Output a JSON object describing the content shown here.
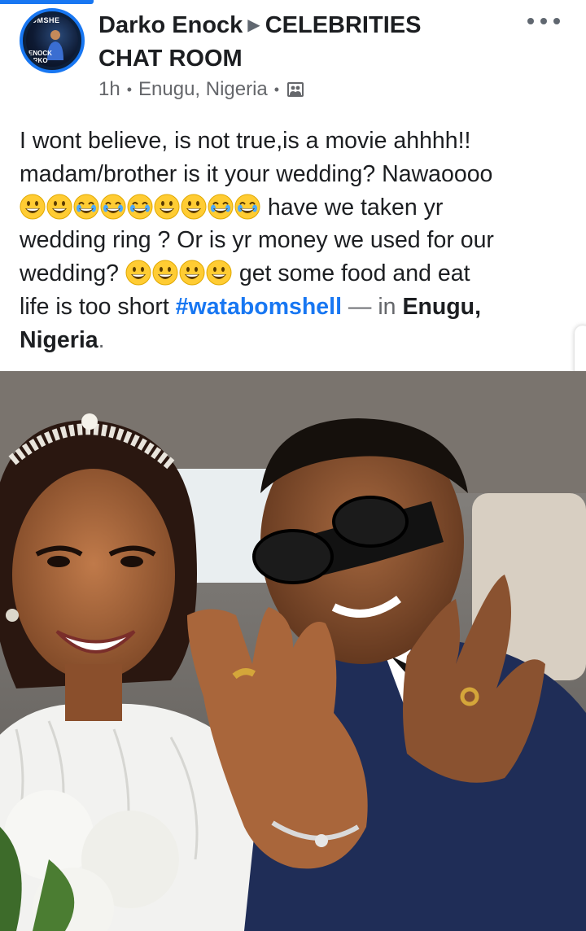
{
  "post": {
    "author": "Darko Enock",
    "group": "CELEBRITIES CHAT ROOM",
    "group_line1": "CELEBRITIES",
    "group_line2": "CHAT ROOM",
    "time": "1h",
    "location": "Enugu, Nigeria",
    "separator": "•",
    "privacy_icon": "group-photo-icon",
    "more_icon": "more-options-icon",
    "avatar": {
      "text_top": "OMSHE",
      "text_bottom_1": "ENOCK",
      "text_bottom_2": "ARKO"
    },
    "body": {
      "line1": "I wont believe, is not true,is a movie ahhhh!!",
      "line2": "madam/brother is it your wedding? Nawaoooo",
      "line3_text": "have we taken yr",
      "line4": "wedding ring ?   Or is yr money we used for our",
      "line5_text": "wedding?",
      "line5_after": "get some food and eat",
      "line6_text": "life is too short ",
      "hashtag": "#watabomshell",
      "tag_in": " — in ",
      "place": "Enugu,",
      "place2": "Nigeria",
      "period": "."
    },
    "emoji_sequence_line3": [
      "grinning",
      "grinning",
      "joy",
      "joy",
      "joy",
      "grinning",
      "grinning",
      "joy",
      "joy"
    ],
    "emoji_sequence_line5": [
      "grinning",
      "grinning",
      "grinning",
      "grinning"
    ],
    "photo_alt": "Wedding couple photo"
  },
  "colors": {
    "accent": "#1877f2",
    "text": "#1c1e21",
    "secondary": "#65676b",
    "emoji_yellow": "#ffcc33"
  }
}
